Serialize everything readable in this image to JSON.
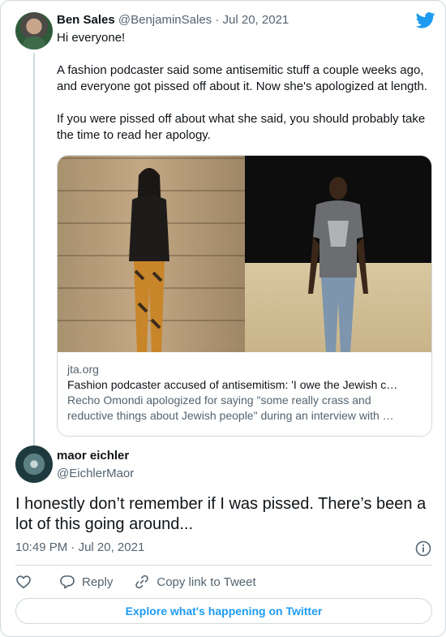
{
  "parent_tweet": {
    "name": "Ben Sales",
    "handle": "@BenjaminSales",
    "date": "Jul 20, 2021",
    "paragraphs": [
      "Hi everyone!",
      "A fashion podcaster said some antisemitic stuff a couple weeks ago, and everyone got pissed off about it. Now she's apologized at length.",
      "If you were pissed off about what she said, you should probably take the time to read her apology."
    ],
    "card": {
      "domain": "jta.org",
      "title": "Fashion podcaster accused of antisemitism: 'I owe the Jewish c…",
      "desc_line1": "Recho Omondi apologized for saying \"some really crass and",
      "desc_line2": "reductive things about Jewish people\" during an interview with …"
    }
  },
  "tweet": {
    "name": "maor eichler",
    "handle": "@EichlerMaor",
    "text": "I honestly don’t remember if I was pissed. There’s been a lot of this going around...",
    "time": "10:49 PM",
    "date": "Jul 20, 2021"
  },
  "actions": {
    "reply": "Reply",
    "copy_link": "Copy link to Tweet"
  },
  "explore_label": "Explore what's happening on Twitter",
  "colors": {
    "brand": "#1d9bf0",
    "text": "#0f1419",
    "muted": "#536471",
    "border": "#cfd9de"
  },
  "icons": [
    "twitter-bird-icon",
    "heart-icon",
    "reply-icon",
    "link-icon",
    "info-icon"
  ]
}
